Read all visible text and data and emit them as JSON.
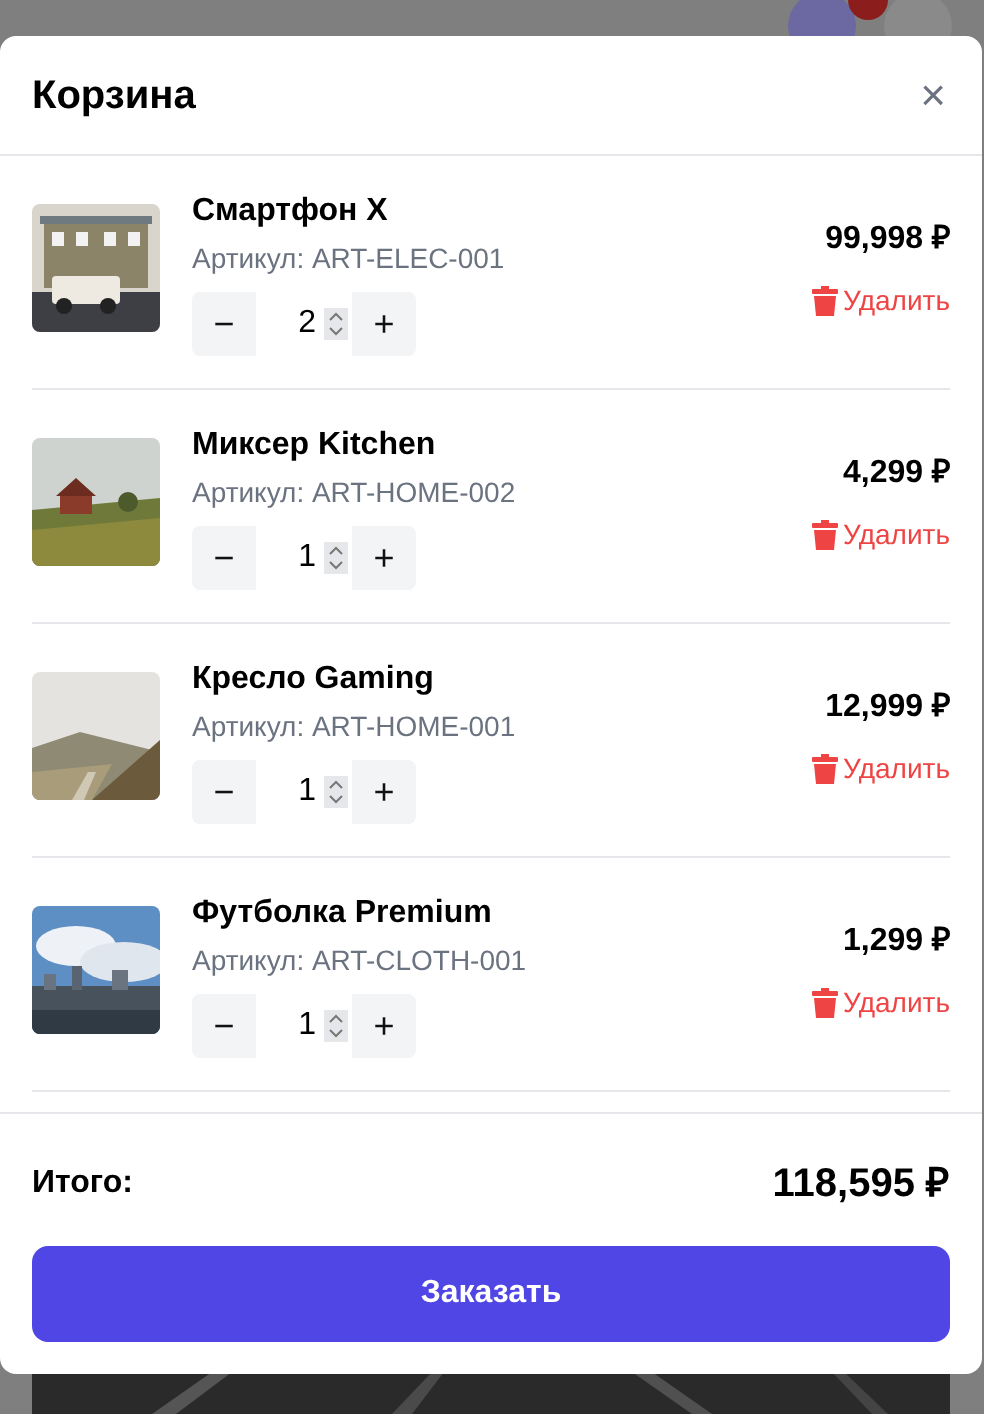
{
  "modal": {
    "title": "Корзина",
    "close": "×",
    "items": [
      {
        "name": "Смартфон X",
        "sku": "Артикул: ART-ELEC-001",
        "quantity": "2",
        "price": "99,998 ₽",
        "remove": "Удалить"
      },
      {
        "name": "Миксер Kitchen",
        "sku": "Артикул: ART-HOME-002",
        "quantity": "1",
        "price": "4,299 ₽",
        "remove": "Удалить"
      },
      {
        "name": "Кресло Gaming",
        "sku": "Артикул: ART-HOME-001",
        "quantity": "1",
        "price": "12,999 ₽",
        "remove": "Удалить"
      },
      {
        "name": "Футболка Premium",
        "sku": "Артикул: ART-CLOTH-001",
        "quantity": "1",
        "price": "1,299 ₽",
        "remove": "Удалить"
      }
    ],
    "total_label": "Итого:",
    "total": "118,595 ₽",
    "checkout": "Заказать",
    "decrement": "−",
    "increment": "+"
  }
}
